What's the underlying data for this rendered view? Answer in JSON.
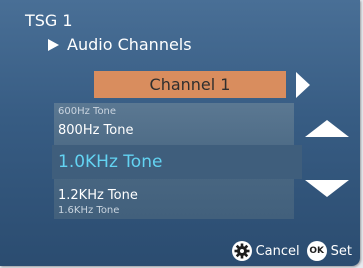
{
  "header": {
    "title": "TSG 1",
    "breadcrumb": "Audio Channels"
  },
  "channel": {
    "selected": "Channel 1"
  },
  "tone_list": {
    "items": [
      {
        "label": "600Hz Tone"
      },
      {
        "label": "800Hz Tone"
      },
      {
        "label": "1.0KHz Tone"
      },
      {
        "label": "1.2KHz Tone"
      },
      {
        "label": "1.6KHz Tone"
      }
    ],
    "selected_index": 2
  },
  "footer": {
    "cancel_label": "Cancel",
    "ok_badge": "OK",
    "set_label": "Set"
  },
  "colors": {
    "background": "#375c83",
    "channel_box": "#d98d5e",
    "selected_text": "#63d3f2",
    "list_background": "#4a6883"
  }
}
